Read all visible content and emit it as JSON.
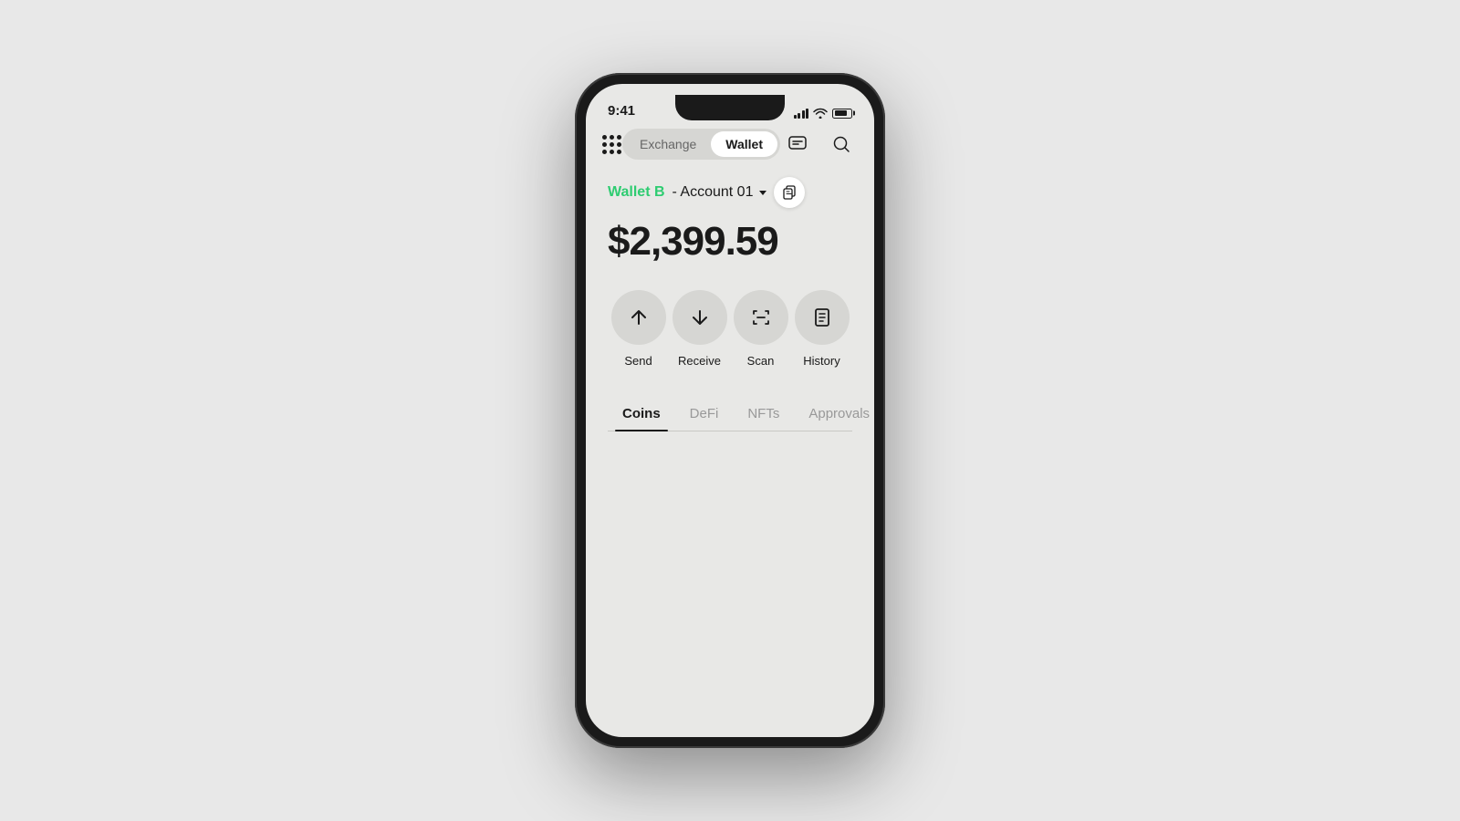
{
  "background": "#e8e8e8",
  "phone": {
    "statusBar": {
      "time": "9:41"
    },
    "header": {
      "exchangeLabel": "Exchange",
      "walletLabel": "Wallet",
      "activeTab": "Wallet"
    },
    "account": {
      "name": "Wallet B",
      "info": "- Account 01",
      "balance": "$2,399.59"
    },
    "actions": [
      {
        "id": "send",
        "label": "Send"
      },
      {
        "id": "receive",
        "label": "Receive"
      },
      {
        "id": "scan",
        "label": "Scan"
      },
      {
        "id": "history",
        "label": "History"
      }
    ],
    "tabs": [
      {
        "id": "coins",
        "label": "Coins",
        "active": true
      },
      {
        "id": "defi",
        "label": "DeFi",
        "active": false
      },
      {
        "id": "nfts",
        "label": "NFTs",
        "active": false
      },
      {
        "id": "approvals",
        "label": "Approvals",
        "active": false
      }
    ]
  }
}
